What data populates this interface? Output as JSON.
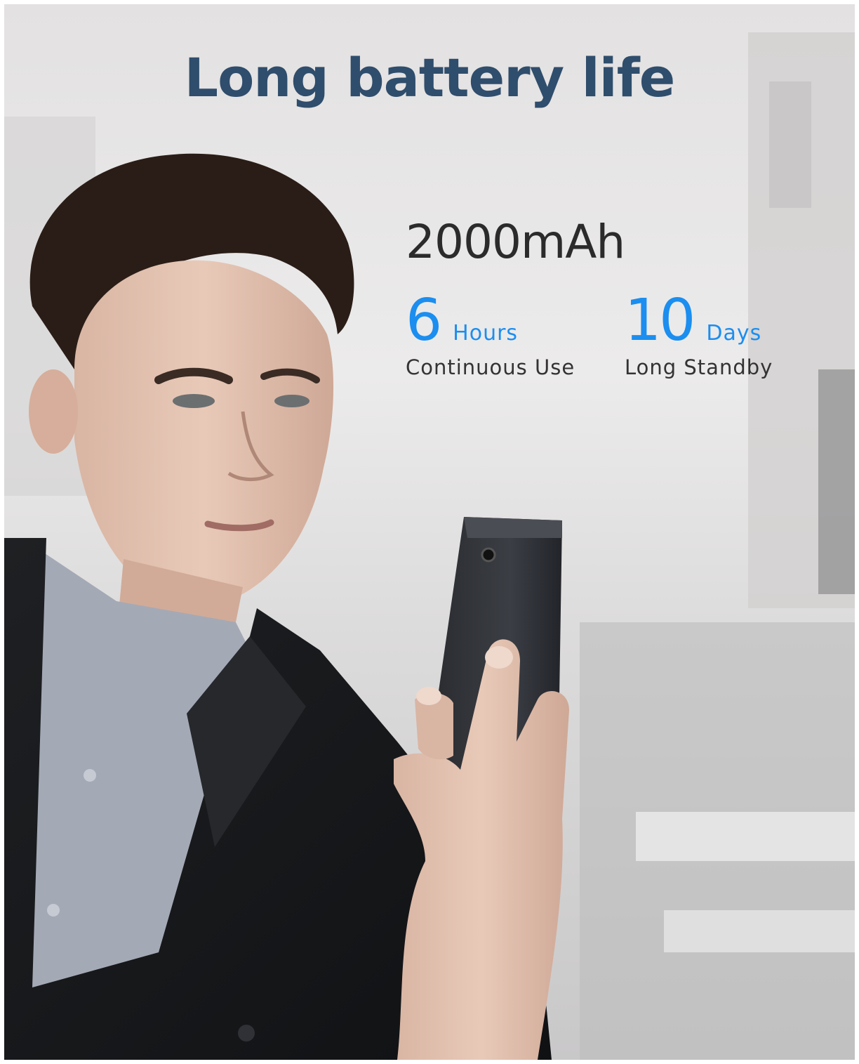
{
  "headline": "Long battery life",
  "battery": {
    "capacity": "2000mAh",
    "stats": [
      {
        "number": "6",
        "unit": "Hours",
        "caption": "Continuous Use"
      },
      {
        "number": "10",
        "unit": "Days",
        "caption": "Long Standby"
      }
    ]
  },
  "colors": {
    "headline": "#2f4d6c",
    "accent": "#1b8ef0",
    "text": "#333333"
  }
}
